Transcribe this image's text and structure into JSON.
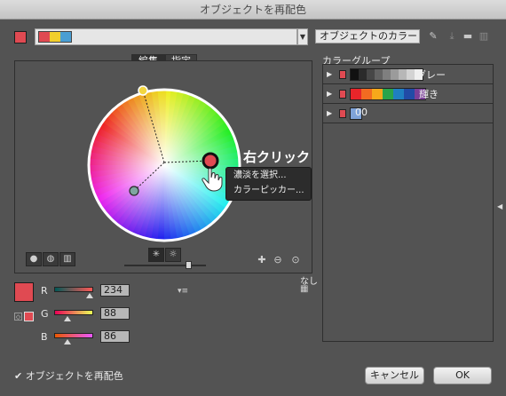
{
  "window": {
    "title": "オブジェクトを再配色"
  },
  "toolbar": {
    "current_colors": [
      "#e04a52",
      "#f2cf2b",
      "#4a9ed3"
    ],
    "harmony_dropdown": "オブジェクトのカラー",
    "icons": [
      "eyedropper-icon",
      "save-group-icon",
      "folder-icon",
      "trash-icon"
    ]
  },
  "tabs": [
    {
      "label": "編集",
      "active": true
    },
    {
      "label": "指定",
      "active": false
    }
  ],
  "context_menu": {
    "items": [
      "濃淡を選択...",
      "カラーピッカー..."
    ]
  },
  "annotation": {
    "text": "右クリック"
  },
  "color_sliders": {
    "channels": [
      {
        "label": "R",
        "value": "234",
        "position": 0.92
      },
      {
        "label": "G",
        "value": "88",
        "position": 0.35
      },
      {
        "label": "B",
        "value": "86",
        "position": 0.34
      }
    ],
    "none_label": "なし"
  },
  "color_groups": {
    "title": "カラーグループ",
    "groups": [
      {
        "name": "グレー",
        "colors": [
          "#111111",
          "#2b2b2b",
          "#474747",
          "#636363",
          "#7f7f7f",
          "#9b9b9b",
          "#b7b7b7",
          "#d3d3d3",
          "#efefef"
        ]
      },
      {
        "name": "輝き",
        "colors": [
          "#e8252a",
          "#f26b21",
          "#f7a81b",
          "#2aa34a",
          "#1f7fc1",
          "#214ba6",
          "#7a3f98"
        ]
      },
      {
        "name": "00",
        "colors": [
          "#7fa3d9"
        ]
      }
    ]
  },
  "footer": {
    "checkbox_label": "オブジェクトを再配色",
    "checkbox_checked": true,
    "cancel_label": "キャンセル",
    "ok_label": "OK"
  },
  "colors": {
    "accent": "#e04a52",
    "wheel_rim": "#ffffff",
    "dialog_bg": "#535353"
  }
}
